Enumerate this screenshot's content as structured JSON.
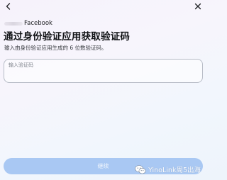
{
  "header": {
    "back_icon": "chevron-left-icon",
    "close_icon": "close-icon"
  },
  "account": {
    "platform": "Facebook"
  },
  "page": {
    "title": "通过身份验证应用获取验证码",
    "subtitle": "输入由身份验证应用生成的 6 位数验证码。"
  },
  "code_input": {
    "label": "输入验证码",
    "value": ""
  },
  "footer": {
    "continue_label": "继续"
  },
  "watermark": {
    "logo": "wechat-logo",
    "text": "YinoLink周5出海"
  },
  "colors": {
    "button_bg": "#a9c8f3",
    "text_primary": "#1c1e21",
    "border": "#b7bcc6"
  }
}
